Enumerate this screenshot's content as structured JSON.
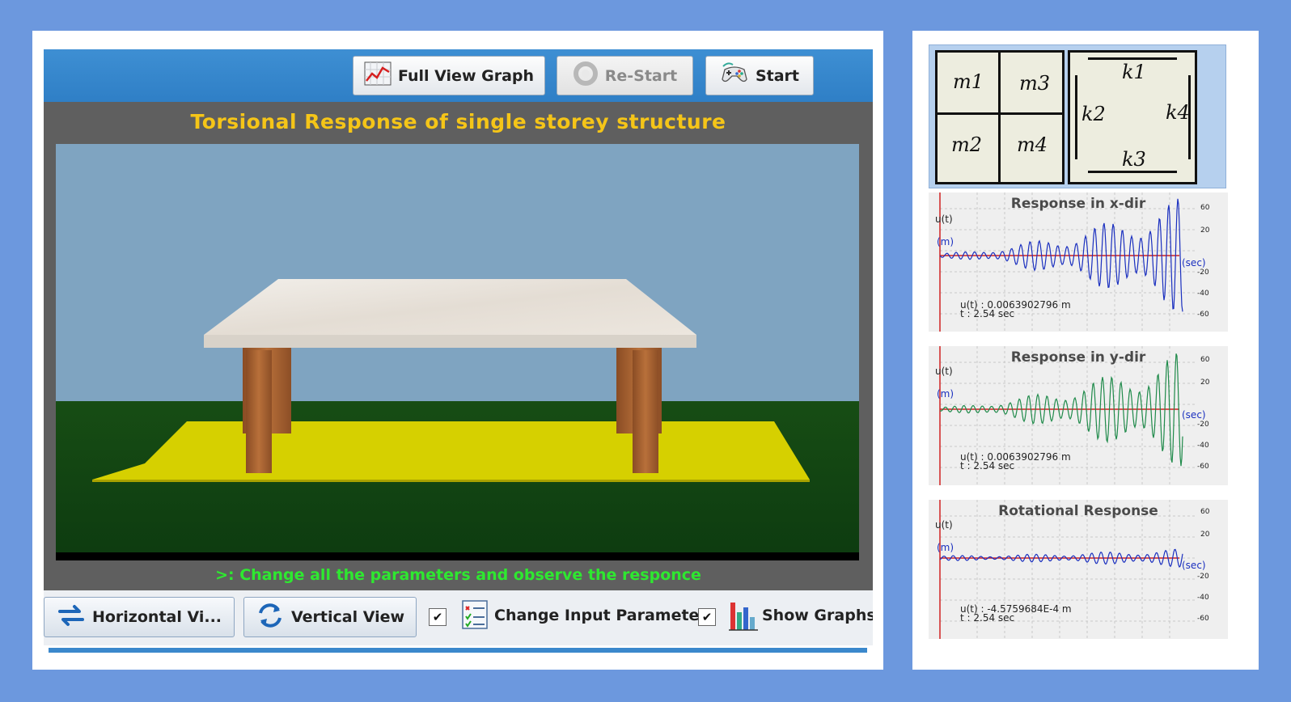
{
  "toolbar": {
    "full_view_label": "Full View Graph",
    "restart_label": "Re-Start",
    "start_label": "Start"
  },
  "simulation": {
    "title": "Torsional Response of single storey structure",
    "note": ">: Change all the parameters and observe the responce"
  },
  "bottom_bar": {
    "horizontal_label": "Horizontal Vi...",
    "vertical_label": "Vertical View",
    "change_params_label": "Change Input Parameters",
    "change_params_checked": "✔",
    "show_graphs_label": "Show Graphs",
    "show_graphs_checked": "✔"
  },
  "legend": {
    "masses": [
      "m1",
      "m3",
      "m2",
      "m4"
    ],
    "stiffness": [
      "k1",
      "k2",
      "k4",
      "k3"
    ]
  },
  "graphs": [
    {
      "title": "Response in x-dir",
      "ylabel": "u(t)",
      "yunit": "(m)",
      "xunit": "(sec)",
      "yticks": [
        "60",
        "20",
        "-20",
        "-40",
        "-60"
      ],
      "readout_u": "u(t) : 0.0063902796 m",
      "readout_t": "t : 2.54 sec",
      "color": "#1a2fbf"
    },
    {
      "title": "Response in y-dir",
      "ylabel": "u(t)",
      "yunit": "(m)",
      "xunit": "(sec)",
      "yticks": [
        "60",
        "20",
        "-20",
        "-40",
        "-60"
      ],
      "readout_u": "u(t) : 0.0063902796 m",
      "readout_t": "t : 2.54 sec",
      "color": "#1f8a4a"
    },
    {
      "title": "Rotational Response",
      "ylabel": "u(t)",
      "yunit": "(m)",
      "xunit": "(sec)",
      "yticks": [
        "60",
        "20",
        "-20",
        "-40",
        "-60"
      ],
      "readout_u": "u(t) : -4.5759684E-4 m",
      "readout_t": "t : 2.54 sec",
      "color": "#1a2fbf"
    }
  ],
  "colors": {
    "background": "#6c98de",
    "title_text": "#f5c518",
    "note_text": "#2ee830",
    "toolbar": "#3e8fd3",
    "axis_line": "#d02020"
  }
}
